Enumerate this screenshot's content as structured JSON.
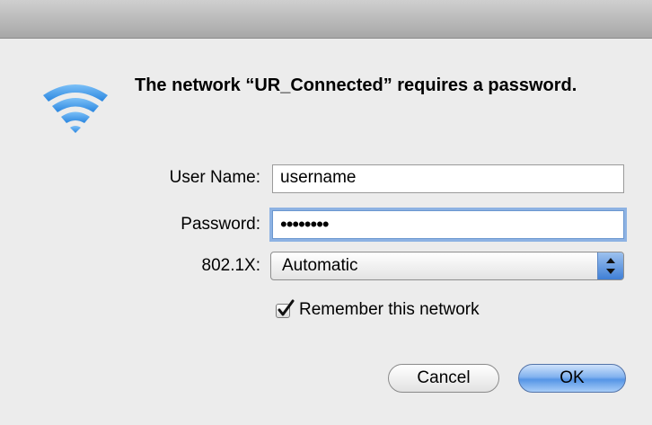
{
  "dialog": {
    "message": "The network “UR_Connected” requires a password."
  },
  "form": {
    "username_label": "User Name:",
    "username_value": "username",
    "password_label": "Password:",
    "password_value": "••••••••",
    "security_label": "802.1X:",
    "security_value": "Automatic",
    "remember_label": "Remember this network",
    "remember_checked": true
  },
  "buttons": {
    "cancel_label": "Cancel",
    "ok_label": "OK"
  },
  "icons": {
    "wifi": "wifi-icon",
    "checkmark": "checkmark-icon",
    "select_arrows": "up-down-arrows-icon"
  },
  "colors": {
    "wifi_blue": "#3f96e8",
    "focus_ring": "#8db2e3",
    "default_button": "#5595e6"
  }
}
